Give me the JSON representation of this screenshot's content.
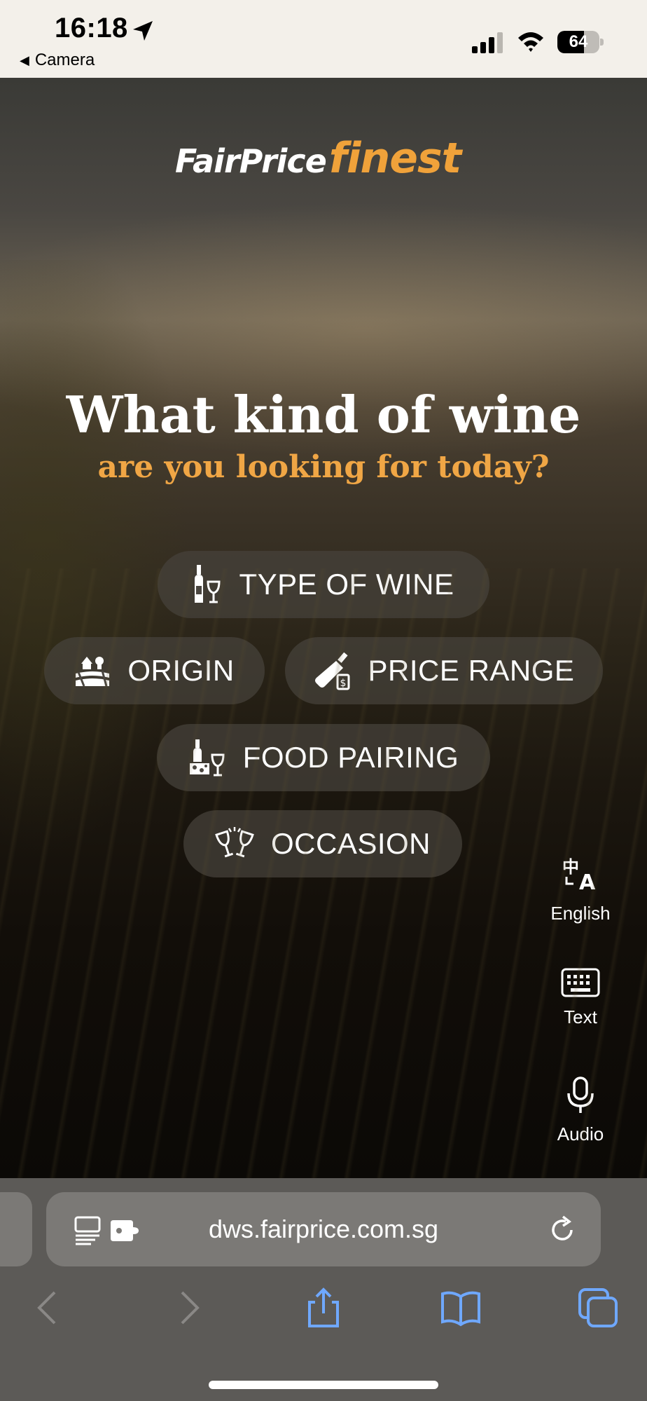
{
  "status_bar": {
    "time": "16:18",
    "back_app": "Camera",
    "battery_level": "64",
    "battery_fraction": 0.64
  },
  "brand": {
    "logo_part1": "FairPrice",
    "logo_part2": "finest",
    "accent_color": "#f0a23a"
  },
  "hero": {
    "headline": "What kind of wine",
    "subheadline": "are you looking for today?"
  },
  "options": [
    {
      "label": "TYPE OF WINE",
      "icon": "wine-bottle-glass-icon"
    },
    {
      "label": "ORIGIN",
      "icon": "vineyard-icon"
    },
    {
      "label": "PRICE RANGE",
      "icon": "bottle-price-tag-icon"
    },
    {
      "label": "FOOD PAIRING",
      "icon": "cheese-wine-icon"
    },
    {
      "label": "OCCASION",
      "icon": "cheers-glasses-icon"
    }
  ],
  "side_tools": [
    {
      "label": "English",
      "icon": "translate-icon"
    },
    {
      "label": "Text",
      "icon": "keyboard-icon"
    },
    {
      "label": "Audio",
      "icon": "microphone-icon"
    }
  ],
  "browser": {
    "url": "dws.fairprice.com.sg",
    "toolbar_icons": [
      "back-icon",
      "forward-icon",
      "share-icon",
      "bookmarks-icon",
      "tabs-icon"
    ],
    "toolbar_color": "#6fa8ff"
  }
}
